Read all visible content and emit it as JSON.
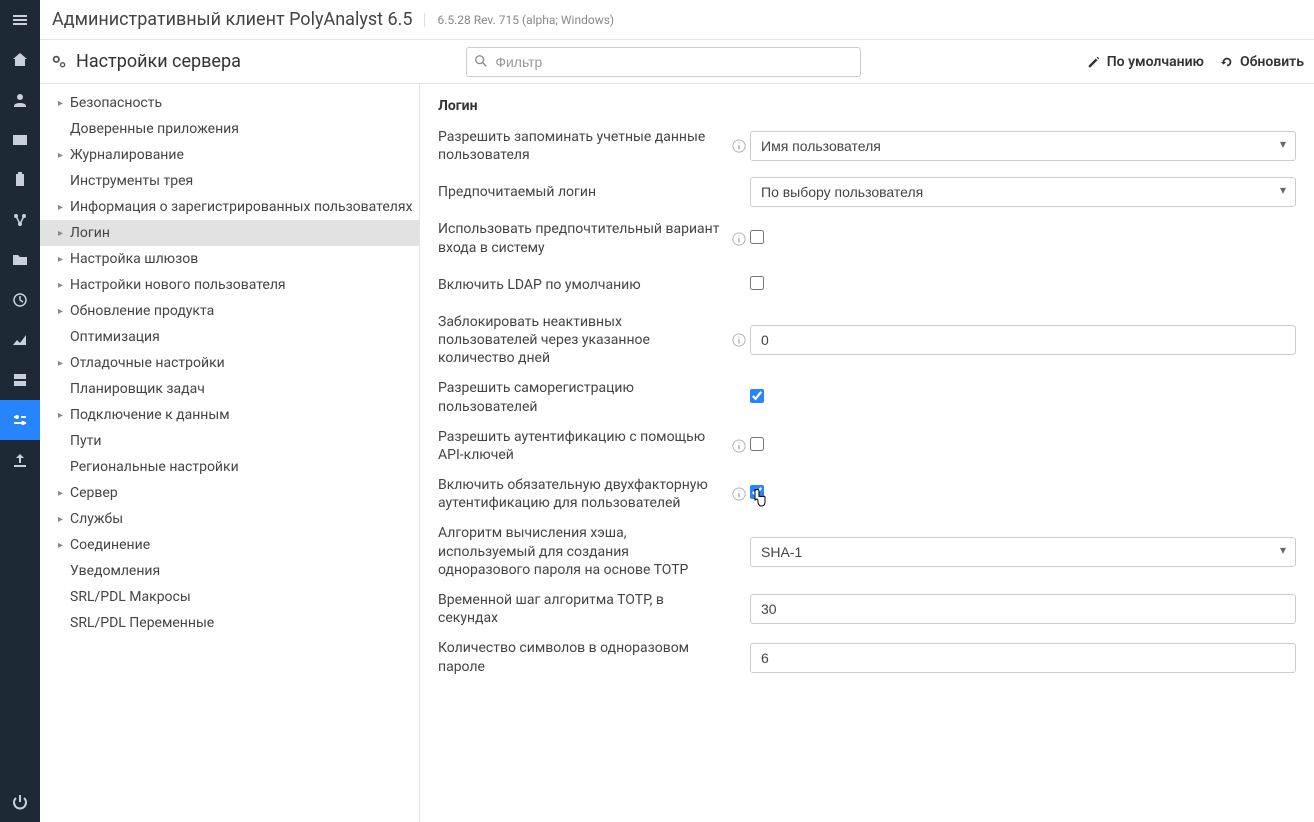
{
  "header": {
    "title": "Административный клиент PolyAnalyst 6.5",
    "version": "6.5.28 Rev. 715 (alpha; Windows)"
  },
  "toolbar": {
    "page_title": "Настройки сервера",
    "filter_placeholder": "Фильтр",
    "defaults_label": "По умолчанию",
    "refresh_label": "Обновить"
  },
  "tree": {
    "items": [
      {
        "label": "Безопасность",
        "caret": true
      },
      {
        "label": "Доверенные приложения",
        "caret": false
      },
      {
        "label": "Журналирование",
        "caret": true
      },
      {
        "label": "Инструменты трея",
        "caret": false
      },
      {
        "label": "Информация о зарегистрированных пользователях",
        "caret": true
      },
      {
        "label": "Логин",
        "caret": true,
        "selected": true
      },
      {
        "label": "Настройка шлюзов",
        "caret": true
      },
      {
        "label": "Настройки нового пользователя",
        "caret": true
      },
      {
        "label": "Обновление продукта",
        "caret": true
      },
      {
        "label": "Оптимизация",
        "caret": false
      },
      {
        "label": "Отладочные настройки",
        "caret": true
      },
      {
        "label": "Планировщик задач",
        "caret": false
      },
      {
        "label": "Подключение к данным",
        "caret": true
      },
      {
        "label": "Пути",
        "caret": false
      },
      {
        "label": "Региональные настройки",
        "caret": false
      },
      {
        "label": "Сервер",
        "caret": true
      },
      {
        "label": "Службы",
        "caret": true
      },
      {
        "label": "Соединение",
        "caret": true
      },
      {
        "label": "Уведомления",
        "caret": false
      },
      {
        "label": "SRL/PDL Макросы",
        "caret": false
      },
      {
        "label": "SRL/PDL Переменные",
        "caret": false
      }
    ]
  },
  "form": {
    "title": "Логин",
    "rows": {
      "remember": {
        "label": "Разрешить запоминать учетные данные пользователя",
        "value": "Имя пользователя"
      },
      "preferred": {
        "label": "Предпочитаемый логин",
        "value": "По выбору пользователя"
      },
      "use_preferred": {
        "label": "Использовать предпочтительный вариант входа в систему"
      },
      "ldap": {
        "label": "Включить LDAP по умолчанию"
      },
      "block_inactive": {
        "label": "Заблокировать неактивных пользователей через указанное количество дней",
        "value": "0"
      },
      "self_reg": {
        "label": "Разрешить саморегистрацию пользователей"
      },
      "api_keys": {
        "label": "Разрешить аутентификацию с помощью API-ключей"
      },
      "twofa": {
        "label": "Включить обязательную двухфакторную аутентификацию для пользователей"
      },
      "hash": {
        "label": "Алгоритм вычисления хэша, используемый для создания одноразового пароля на основе ТОТР",
        "value": "SHA-1"
      },
      "step": {
        "label": "Временной шаг алгоритма ТОТР, в секундах",
        "value": "30"
      },
      "digits": {
        "label": "Количество символов в одноразовом пароле",
        "value": "6"
      }
    }
  }
}
